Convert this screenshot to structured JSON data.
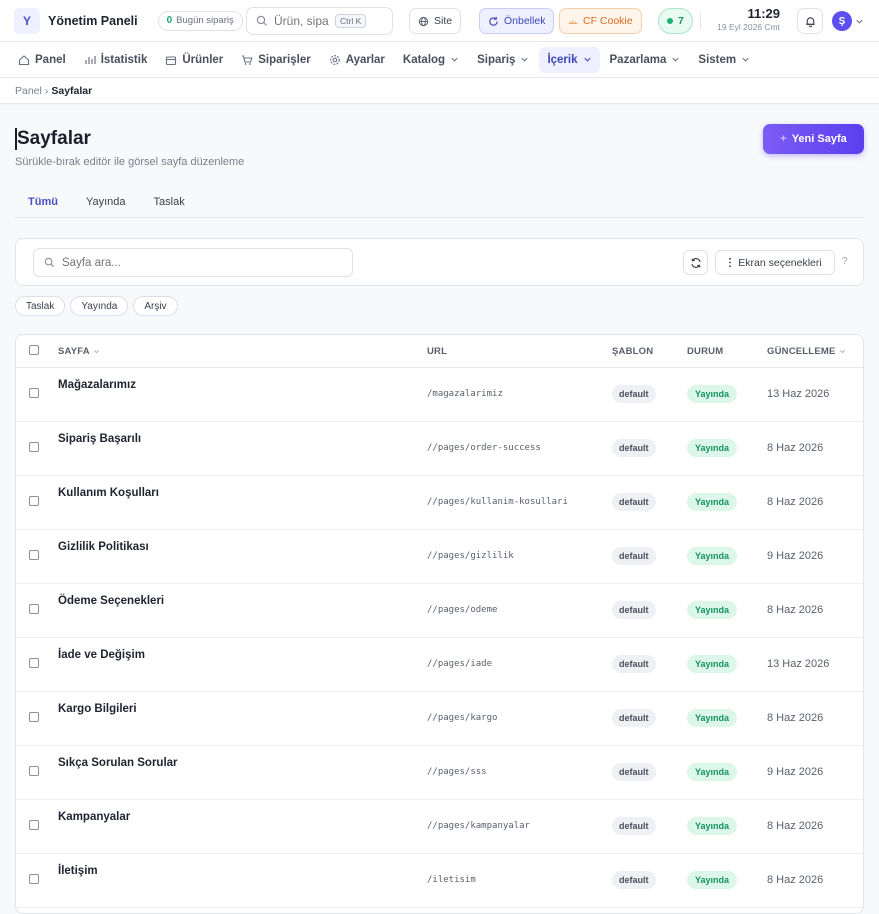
{
  "topbar": {
    "logo_letter": "Y",
    "app_title": "Yönetim Paneli",
    "orders_count": "0",
    "orders_label": "Bugün sipariş",
    "search_placeholder": "Ürün, sipa",
    "search_shortcut": "Ctrl K",
    "site_label": "Site",
    "cache_label": "Önbellek",
    "cf_label": "CF Cookie",
    "online_count": "7",
    "time": "11:29",
    "date": "19 Eyl 2026 Cmt",
    "avatar_letter": "Ş"
  },
  "nav": {
    "items": [
      {
        "label": "Panel",
        "icon": "home-icon"
      },
      {
        "label": "İstatistik",
        "icon": "chart-icon"
      },
      {
        "label": "Ürünler",
        "icon": "box-icon"
      },
      {
        "label": "Siparişler",
        "icon": "cart-icon"
      },
      {
        "label": "Ayarlar",
        "icon": "gear-icon"
      },
      {
        "label": "Katalog",
        "icon": "chevron-down-icon"
      },
      {
        "label": "Sipariş",
        "icon": "chevron-down-icon"
      },
      {
        "label": "İçerik",
        "icon": "chevron-down-icon",
        "active": true
      },
      {
        "label": "Pazarlama",
        "icon": "chevron-down-icon"
      },
      {
        "label": "Sistem",
        "icon": "chevron-down-icon"
      }
    ]
  },
  "breadcrumb": {
    "root": "Panel",
    "separator": "›",
    "current": "Sayfalar"
  },
  "header": {
    "title": "Sayfalar",
    "subtitle": "Sürükle-bırak editör ile görsel sayfa düzenleme",
    "new_button": "Yeni Sayfa"
  },
  "tabs": [
    "Tümü",
    "Yayında",
    "Taslak"
  ],
  "filters": {
    "search_placeholder": "Sayfa ara...",
    "screen_options": "Ekran seçenekleri",
    "help": "?",
    "chips": [
      "Taslak",
      "Yayında",
      "Arşiv"
    ]
  },
  "table": {
    "columns": {
      "page": "SAYFA",
      "url": "URL",
      "template": "ŞABLON",
      "status": "DURUM",
      "updated": "GÜNCELLEME"
    },
    "rows": [
      {
        "name": "Mağazalarımız",
        "url": "/magazalarimiz",
        "template": "default",
        "status": "Yayında",
        "updated": "13 Haz 2026"
      },
      {
        "name": "Sipariş Başarılı",
        "url": "//pages/order-success",
        "template": "default",
        "status": "Yayında",
        "updated": "8 Haz 2026"
      },
      {
        "name": "Kullanım Koşulları",
        "url": "//pages/kullanim-kosullari",
        "template": "default",
        "status": "Yayında",
        "updated": "8 Haz 2026"
      },
      {
        "name": "Gizlilik Politikası",
        "url": "//pages/gizlilik",
        "template": "default",
        "status": "Yayında",
        "updated": "9 Haz 2026"
      },
      {
        "name": "Ödeme Seçenekleri",
        "url": "//pages/odeme",
        "template": "default",
        "status": "Yayında",
        "updated": "8 Haz 2026"
      },
      {
        "name": "İade ve Değişim",
        "url": "//pages/iade",
        "template": "default",
        "status": "Yayında",
        "updated": "13 Haz 2026"
      },
      {
        "name": "Kargo Bilgileri",
        "url": "//pages/kargo",
        "template": "default",
        "status": "Yayında",
        "updated": "8 Haz 2026"
      },
      {
        "name": "Sıkça Sorulan Sorular",
        "url": "//pages/sss",
        "template": "default",
        "status": "Yayında",
        "updated": "9 Haz 2026"
      },
      {
        "name": "Kampanyalar",
        "url": "//pages/kampanyalar",
        "template": "default",
        "status": "Yayında",
        "updated": "8 Haz 2026"
      },
      {
        "name": "İletişim",
        "url": "/iletisim",
        "template": "default",
        "status": "Yayında",
        "updated": "8 Haz 2026"
      }
    ]
  },
  "colors": {
    "accent": "#5b3ff0",
    "active_nav": "#3e44b8",
    "status_published": "#16935f",
    "cf_orange": "#d96b1b"
  }
}
